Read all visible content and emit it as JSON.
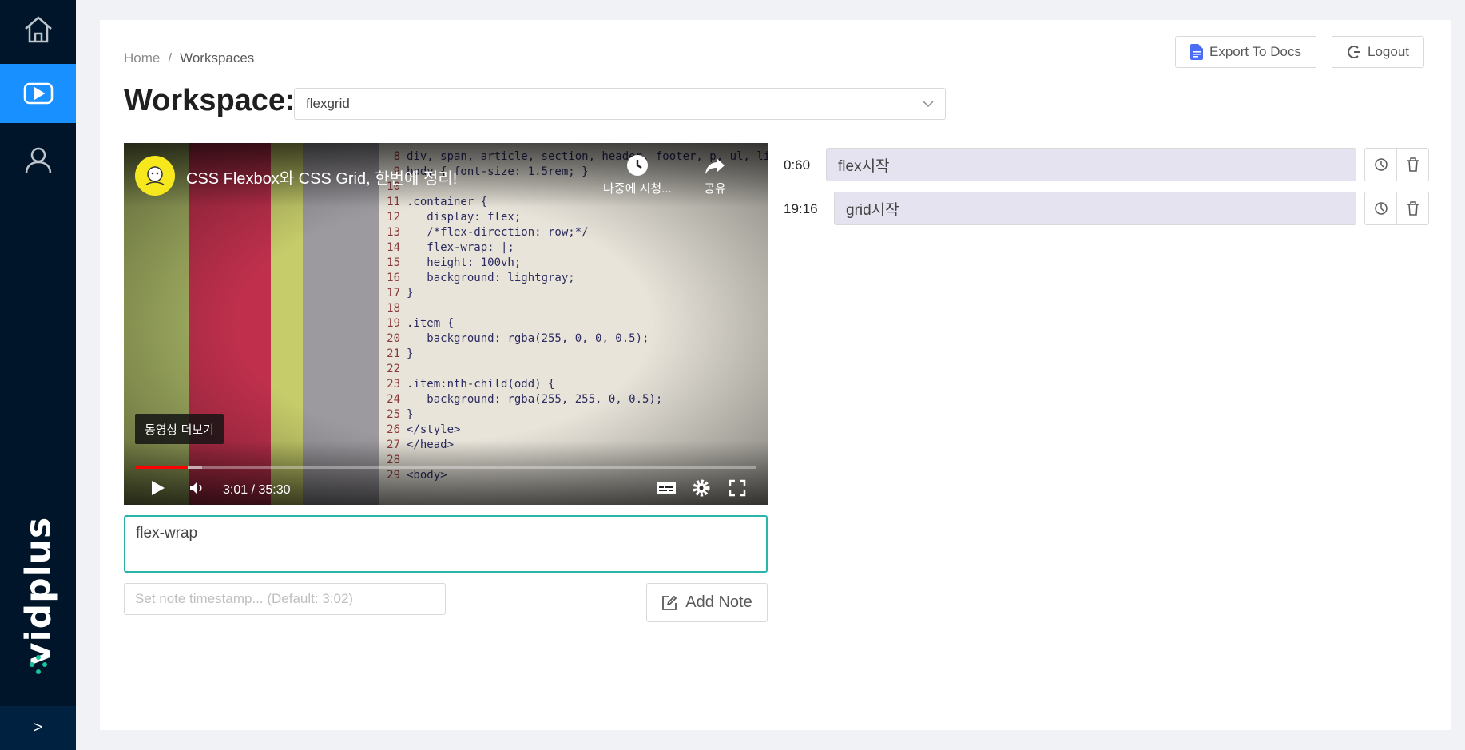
{
  "sidebar": {
    "items": [
      {
        "name": "home",
        "icon": "home-icon"
      },
      {
        "name": "videos",
        "icon": "play-icon",
        "active": true
      },
      {
        "name": "profile",
        "icon": "user-icon"
      }
    ],
    "brand": "vidplus",
    "collapse_label": ">",
    "colors": {
      "bg": "#001529",
      "active": "#1890ff"
    }
  },
  "breadcrumb": {
    "home": "Home",
    "separator": "/",
    "current": "Workspaces"
  },
  "header": {
    "export_label": "Export To Docs",
    "logout_label": "Logout"
  },
  "workspace": {
    "title": "Workspace:",
    "selected": "flexgrid"
  },
  "video": {
    "title": "CSS Flexbox와 CSS Grid, 한번에 정리!",
    "watch_later_label": "나중에 시청...",
    "share_label": "공유",
    "more_videos_label": "동영상 더보기",
    "current_time": "3:01 / 35:30",
    "progress_fraction": 0.085,
    "buffer_fraction": 0.108,
    "code_lines": [
      {
        "n": "8",
        "text": "div, span, article, section, header, footer, p, ul, li"
      },
      {
        "n": "9",
        "text": "body { font-size: 1.5rem; }"
      },
      {
        "n": "10",
        "text": ""
      },
      {
        "n": "11",
        "text": ".container {"
      },
      {
        "n": "12",
        "text": "   display: flex;"
      },
      {
        "n": "13",
        "text": "   /*flex-direction: row;*/"
      },
      {
        "n": "14",
        "text": "   flex-wrap: |;"
      },
      {
        "n": "15",
        "text": "   height: 100vh;"
      },
      {
        "n": "16",
        "text": "   background: lightgray;"
      },
      {
        "n": "17",
        "text": "}"
      },
      {
        "n": "18",
        "text": ""
      },
      {
        "n": "19",
        "text": ".item {"
      },
      {
        "n": "20",
        "text": "   background: rgba(255, 0, 0, 0.5);"
      },
      {
        "n": "21",
        "text": "}"
      },
      {
        "n": "22",
        "text": ""
      },
      {
        "n": "23",
        "text": ".item:nth-child(odd) {"
      },
      {
        "n": "24",
        "text": "   background: rgba(255, 255, 0, 0.5);"
      },
      {
        "n": "25",
        "text": "}"
      },
      {
        "n": "26",
        "text": "</style>"
      },
      {
        "n": "27",
        "text": "</head>"
      },
      {
        "n": "28",
        "text": ""
      },
      {
        "n": "29",
        "text": "<body>"
      }
    ]
  },
  "note_editor": {
    "value": "flex-wrap",
    "timestamp_placeholder": "Set note timestamp... (Default: 3:02)",
    "add_label": "Add Note"
  },
  "notes": [
    {
      "time": "0:60",
      "text": "flex시작"
    },
    {
      "time": "19:16",
      "text": "grid시작"
    }
  ]
}
